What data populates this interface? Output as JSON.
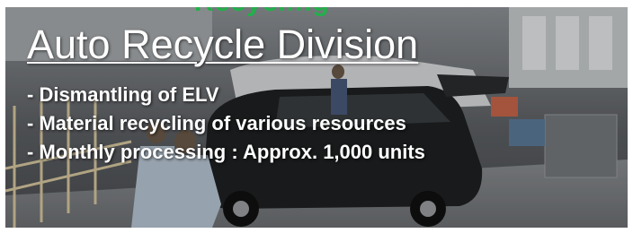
{
  "banner": {
    "top_text": "Recycling",
    "title": "Auto Recycle Division",
    "bullets": [
      "- Dismantling of ELV",
      "- Material recycling of various resources",
      "- Monthly processing : Approx. 1,000 units"
    ]
  },
  "colors": {
    "accent_green": "#22b04a",
    "text": "#ffffff",
    "floor": "#7f8286",
    "car_body": "#1e2022",
    "worker_suit": "#b8c6d4"
  }
}
